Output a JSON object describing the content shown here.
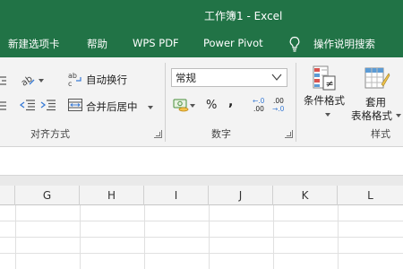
{
  "window": {
    "title": "工作簿1  -  Excel"
  },
  "tabs": [
    {
      "label": "新建选项卡"
    },
    {
      "label": "帮助"
    },
    {
      "label": "WPS PDF"
    },
    {
      "label": "Power Pivot"
    }
  ],
  "tell_me": {
    "label": "操作说明搜索",
    "icon": "lightbulb-icon"
  },
  "ribbon": {
    "alignment": {
      "group_label": "对齐方式",
      "wrap_text": "自动换行",
      "merge_center": "合并后居中"
    },
    "number": {
      "group_label": "数字",
      "format_value": "常规",
      "percent_symbol": "%",
      "comma_symbol": ",",
      "increase_decimal_top": "←.0",
      "increase_decimal_bottom": ".00",
      "decrease_decimal_top": ".00",
      "decrease_decimal_bottom": "→.0"
    },
    "styles": {
      "group_label": "样式",
      "conditional_format": "条件格式",
      "format_table_line1": "套用",
      "format_table_line2": "表格格式"
    }
  },
  "columns": [
    "G",
    "H",
    "I",
    "J",
    "K",
    "L"
  ],
  "colors": {
    "brand": "#217346",
    "ribbon_bg": "#f3f3f3"
  }
}
